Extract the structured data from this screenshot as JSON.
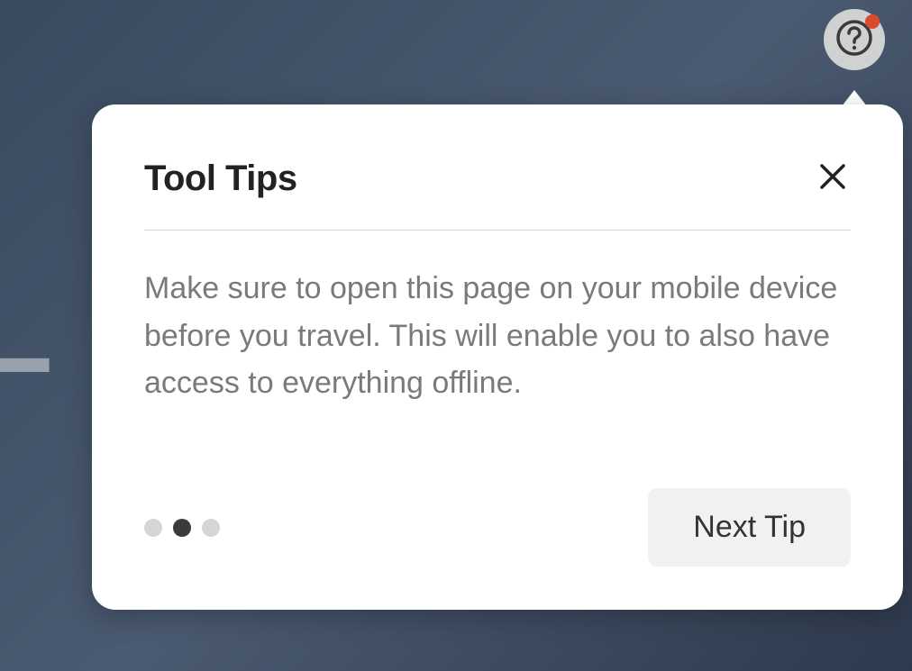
{
  "background": {
    "partial_text": "L"
  },
  "help_button": {
    "has_notification": true
  },
  "popover": {
    "title": "Tool Tips",
    "body": "Make sure to open this page on your mobile device before you travel. This will enable you to also have access to everything offline.",
    "next_label": "Next Tip",
    "pagination": {
      "total": 3,
      "active_index": 1
    }
  }
}
